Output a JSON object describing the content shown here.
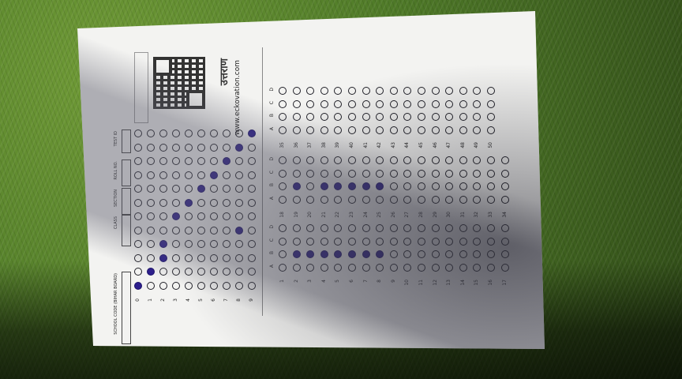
{
  "sheet": {
    "brand": "उत्तराण",
    "website": "www.eckovation.com"
  },
  "id_section": {
    "headers": [
      "SCHOOL CODE (BIHAR BOARD)",
      "CLASS",
      "SECTION",
      "ROLL NO.",
      "TEST ID"
    ],
    "digits": [
      "0",
      "1",
      "2",
      "3",
      "4",
      "5",
      "6",
      "7",
      "8",
      "9"
    ],
    "filled": [
      [
        0,
        0
      ],
      [
        1,
        1
      ],
      [
        2,
        2
      ],
      [
        3,
        2
      ],
      [
        4,
        8
      ],
      [
        5,
        3
      ],
      [
        6,
        4
      ],
      [
        7,
        5
      ],
      [
        8,
        6
      ],
      [
        9,
        7
      ],
      [
        10,
        8
      ],
      [
        11,
        9
      ]
    ]
  },
  "answers": {
    "options": [
      "A",
      "B",
      "C",
      "D"
    ],
    "blocks": [
      {
        "start": 1,
        "end": 17,
        "filled": {
          "2": 1,
          "3": 1,
          "4": 1,
          "5": 1,
          "6": 1,
          "7": 1,
          "8": 1
        }
      },
      {
        "start": 18,
        "end": 34,
        "filled": {
          "19": 1,
          "21": 1,
          "22": 1,
          "23": 1,
          "24": 1,
          "25": 1
        }
      },
      {
        "start": 35,
        "end": 50,
        "filled": {}
      }
    ]
  }
}
